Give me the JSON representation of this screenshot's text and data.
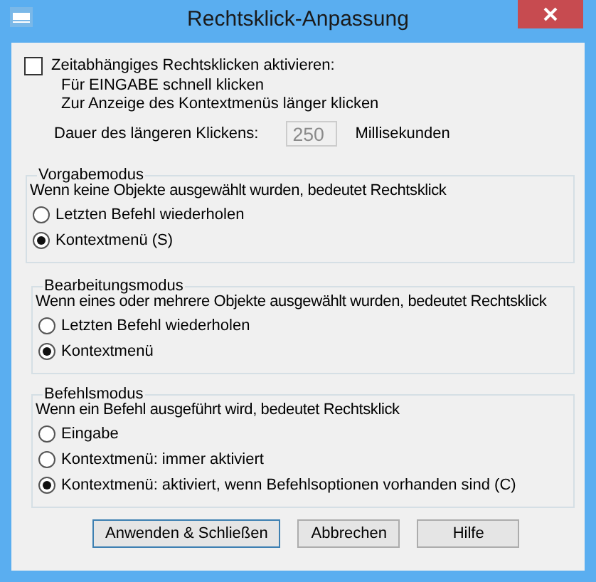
{
  "window": {
    "title": "Rechtsklick-Anpassung"
  },
  "time_option": {
    "label": "Zeitabhängiges Rechtsklicken aktivieren:",
    "checked": false,
    "notes": [
      "Für EINGABE schnell klicken",
      "Zur Anzeige des Kontextmenüs länger klicken"
    ],
    "duration_label": "Dauer des längeren Klickens:",
    "duration_value": "250",
    "duration_disabled": true,
    "unit": "Millisekunden"
  },
  "groups": [
    {
      "title": "Vorgabemodus",
      "description": "Wenn keine Objekte ausgewählt wurden, bedeutet Rechtsklick",
      "options": [
        {
          "label": "Letzten Befehl wiederholen",
          "selected": false
        },
        {
          "label": "Kontextmenü (S)",
          "selected": true
        }
      ]
    },
    {
      "title": "Bearbeitungsmodus",
      "description": "Wenn eines oder mehrere Objekte ausgewählt wurden, bedeutet Rechtsklick",
      "options": [
        {
          "label": "Letzten Befehl wiederholen",
          "selected": false
        },
        {
          "label": "Kontextmenü",
          "selected": true
        }
      ]
    },
    {
      "title": "Befehlsmodus",
      "description": "Wenn ein Befehl ausgeführt wird, bedeutet Rechtsklick",
      "options": [
        {
          "label": "Eingabe",
          "selected": false
        },
        {
          "label": "Kontextmenü: immer aktiviert",
          "selected": false
        },
        {
          "label": "Kontextmenü: aktiviert, wenn Befehlsoptionen vorhanden sind (C)",
          "selected": true
        }
      ]
    }
  ],
  "buttons": [
    {
      "label": "Anwenden & Schließen",
      "default": true
    },
    {
      "label": "Abbrechen",
      "default": false
    },
    {
      "label": "Hilfe",
      "default": false
    }
  ]
}
